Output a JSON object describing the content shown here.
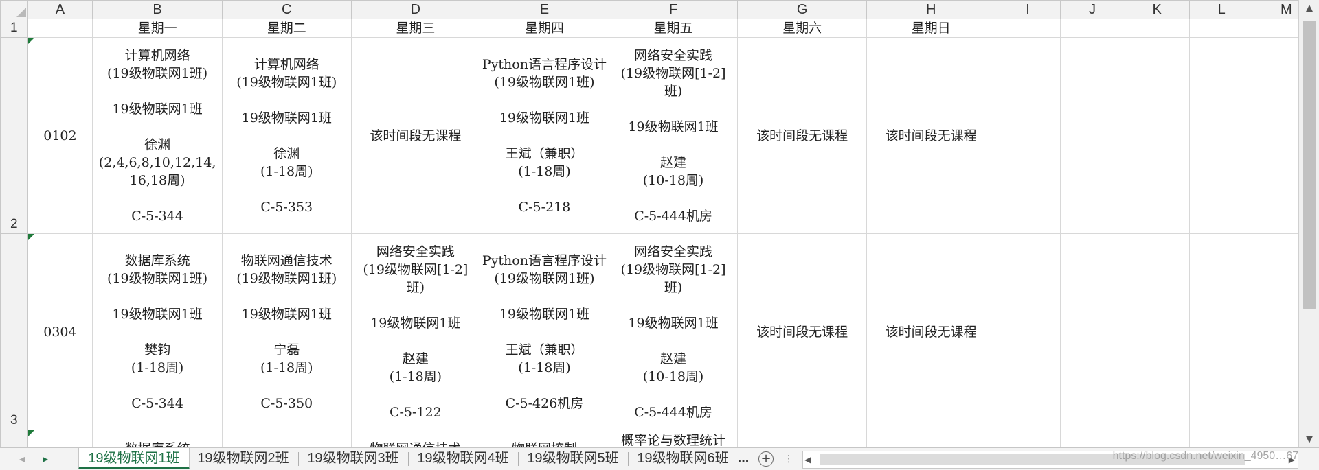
{
  "columns": [
    "A",
    "B",
    "C",
    "D",
    "E",
    "F",
    "G",
    "H",
    "I",
    "J",
    "K",
    "L",
    "M"
  ],
  "row_numbers": [
    "1",
    "2",
    "3"
  ],
  "header_row": [
    "",
    "星期一",
    "星期二",
    "星期三",
    "星期四",
    "星期五",
    "星期六",
    "星期日",
    "",
    "",
    "",
    "",
    ""
  ],
  "rows": [
    {
      "time": "0102",
      "cells": [
        "计算机网络\n(19级物联网1班)\n\n19级物联网1班\n\n徐渊\n(2,4,6,8,10,12,14,\n16,18周)\n\nC-5-344",
        "计算机网络\n(19级物联网1班)\n\n19级物联网1班\n\n徐渊\n(1-18周)\n\nC-5-353",
        "该时间段无课程",
        "Python语言程序设计\n(19级物联网1班)\n\n19级物联网1班\n\n王斌（兼职）\n(1-18周)\n\nC-5-218",
        "网络安全实践\n(19级物联网[1-2]\n班)\n\n19级物联网1班\n\n赵建\n(10-18周)\n\nC-5-444机房",
        "该时间段无课程",
        "该时间段无课程"
      ]
    },
    {
      "time": "0304",
      "cells": [
        "数据库系统\n(19级物联网1班)\n\n19级物联网1班\n\n樊钧\n(1-18周)\n\nC-5-344",
        "物联网通信技术\n(19级物联网1班)\n\n19级物联网1班\n\n宁磊\n(1-18周)\n\nC-5-350",
        "网络安全实践\n(19级物联网[1-2]\n班)\n\n19级物联网1班\n\n赵建\n(1-18周)\n\nC-5-122",
        "Python语言程序设计\n(19级物联网1班)\n\n19级物联网1班\n\n王斌（兼职）\n(1-18周)\n\nC-5-426机房",
        "网络安全实践\n(19级物联网[1-2]\n班)\n\n19级物联网1班\n\n赵建\n(10-18周)\n\nC-5-444机房",
        "该时间段无课程",
        "该时间段无课程"
      ]
    },
    {
      "time": "",
      "cells": [
        "数据库系统",
        "",
        "物联网通信技术",
        "物联网控制",
        "概率论与数理统计",
        "",
        ""
      ]
    }
  ],
  "sheet_tabs": [
    "19级物联网1班",
    "19级物联网2班",
    "19级物联网3班",
    "19级物联网4班",
    "19级物联网5班",
    "19级物联网6班"
  ],
  "active_tab": "19级物联网1班",
  "more_tabs": "...",
  "watermark": "https://blog.csdn.net/weixin_4950…67",
  "colors": {
    "accent_green": "#1e7145",
    "header_bg": "#f2f2f2",
    "grid_line": "#d8d8d8"
  }
}
